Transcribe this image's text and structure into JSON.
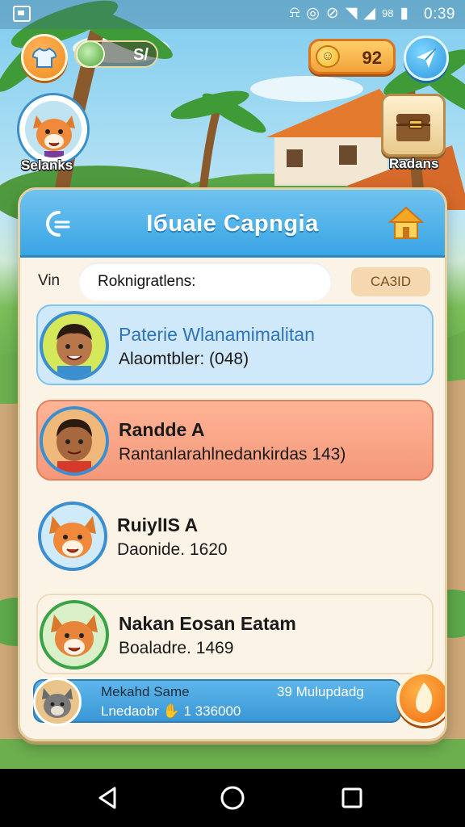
{
  "status_bar": {
    "time": "0:39",
    "icons": [
      "notification-icon",
      "alarm-icon",
      "mute-icon",
      "wifi-icon",
      "signal-icon",
      "battery-icon"
    ],
    "network_text": "98"
  },
  "hud": {
    "cash_value": "S/",
    "coin_value": "92",
    "avatar_label": "Selanks",
    "chest_label": "Radans"
  },
  "panel": {
    "title": "Iбuaie Capngia",
    "filter_label": "Vin",
    "search_value": "Roknigratlens:",
    "card_badge": "CA3ID",
    "entries": [
      {
        "name": "Paterie Wlanamimalitan",
        "detail": "Alaomtbler: (048)"
      },
      {
        "name": "Randde A",
        "detail": "Rantanlarahlnedankirdas 143)"
      },
      {
        "name": "RuiylIS A",
        "detail": "Daonide. 1620"
      },
      {
        "name": "Nakan Eosan Eatam",
        "detail": "Boaladre. 1469"
      }
    ],
    "footer": {
      "name": "Mekahd Same",
      "sub": "Lnedaobr",
      "score": "1 336000",
      "right_text": "39 Mulupdadg"
    }
  },
  "colors": {
    "header_blue": "#3aa5e4",
    "highlight_orange": "#f5987a",
    "accent_orange": "#f08a1e"
  }
}
